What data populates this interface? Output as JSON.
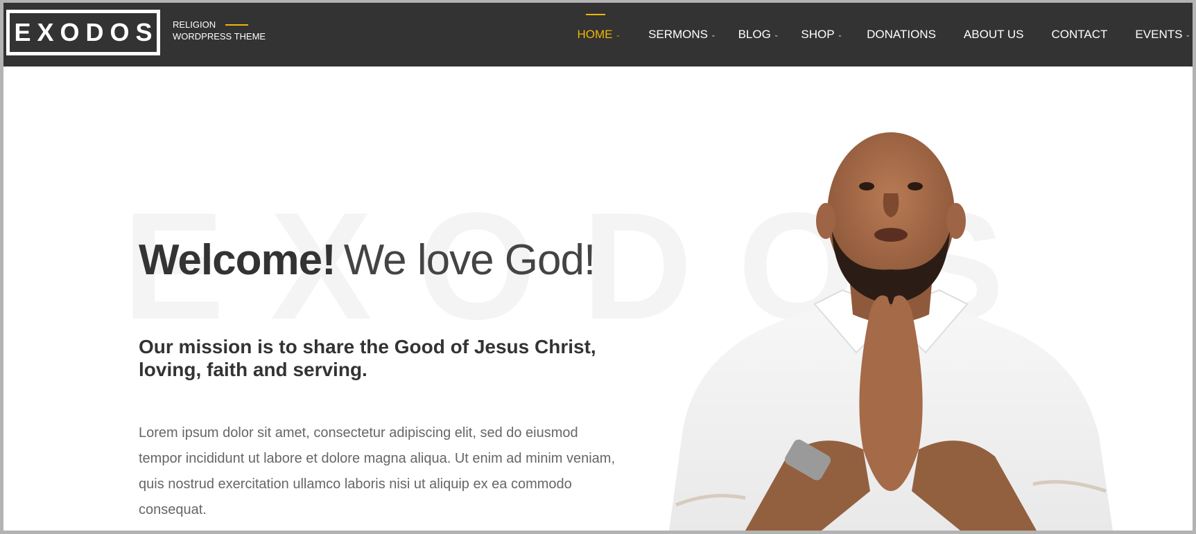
{
  "brand": {
    "logo": "EXODOS",
    "tagline_line1": "RELIGION",
    "tagline_line2": "WORDPRESS THEME"
  },
  "nav": {
    "items": [
      {
        "label": "HOME",
        "has_dropdown": true,
        "active": true
      },
      {
        "label": "SERMONS",
        "has_dropdown": true
      },
      {
        "label": "BLOG",
        "has_dropdown": true
      },
      {
        "label": "SHOP",
        "has_dropdown": true
      },
      {
        "label": "DONATIONS",
        "has_dropdown": false
      },
      {
        "label": "ABOUT US",
        "has_dropdown": false
      },
      {
        "label": "CONTACT",
        "has_dropdown": false
      },
      {
        "label": "EVENTS",
        "has_dropdown": true
      }
    ]
  },
  "hero": {
    "watermark": "EXODOS",
    "title_strong": "Welcome!",
    "title_light": "We love God!",
    "mission": "Our mission is to share the Good of Jesus Christ, loving, faith and serving.",
    "body": "Lorem ipsum dolor sit amet, consectetur adipiscing elit, sed do eiusmod tempor incididunt ut labore et dolore magna aliqua. Ut enim ad minim veniam, quis nostrud exercitation ullamco laboris nisi ut aliquip ex ea commodo consequat."
  },
  "colors": {
    "header_bg": "#333333",
    "accent": "#f2b705",
    "text_dark": "#333333",
    "text_body": "#666666"
  }
}
